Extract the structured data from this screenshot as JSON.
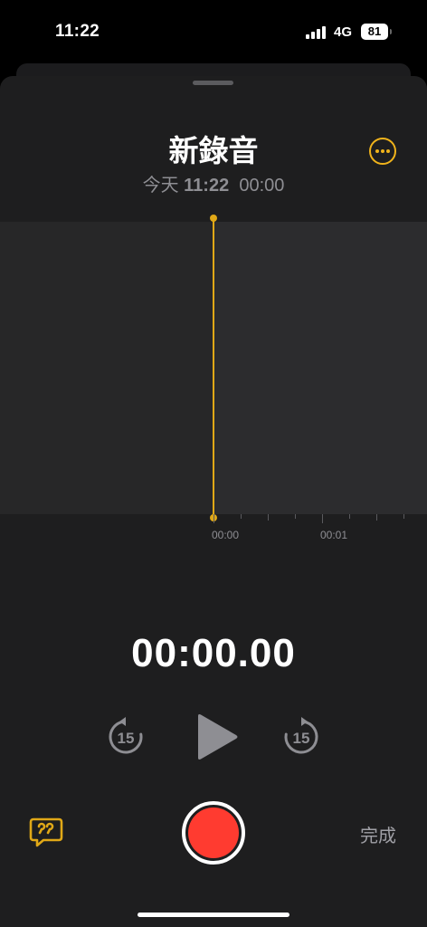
{
  "status_bar": {
    "time": "11:22",
    "network": "4G",
    "battery": "81"
  },
  "recording": {
    "title": "新錄音",
    "date_label": "今天",
    "date_time": "11:22",
    "duration": "00:00"
  },
  "timeline": {
    "labels": [
      "00:00",
      "00:01"
    ]
  },
  "player": {
    "elapsed": "00:00.00",
    "skip_back_seconds": "15",
    "skip_forward_seconds": "15"
  },
  "bottom_bar": {
    "done_label": "完成"
  },
  "colors": {
    "accent": "#f0b31b",
    "record": "#ff3b30",
    "background": "#1e1e1f"
  },
  "icons": [
    "more-icon",
    "skip-back-15-icon",
    "play-icon",
    "skip-forward-15-icon",
    "transcript-icon",
    "record-icon"
  ]
}
